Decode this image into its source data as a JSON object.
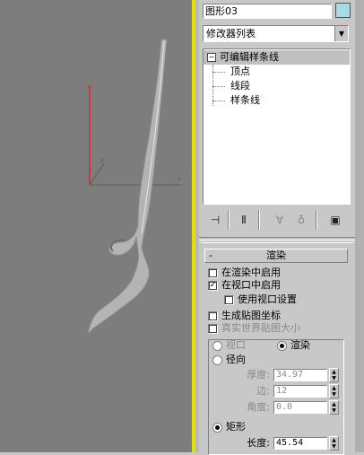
{
  "viewport": {
    "axis_z_label": "z",
    "axis_color_z": "#ff0000",
    "shape_color": "#b4b4b4"
  },
  "panel": {
    "object_name": "图形03",
    "object_color": "#a9dbe6",
    "modifier_list": "修改器列表",
    "stack": {
      "head": "可编辑样条线",
      "head_toggle": "−",
      "items": [
        "顶点",
        "线段",
        "样条线"
      ]
    },
    "icons": [
      "pin-stack-icon",
      "show-end-result-icon",
      "make-unique-icon",
      "remove-modifier-icon",
      "configure-modifier-sets-icon"
    ]
  },
  "render": {
    "title": "渲染",
    "toggle": "-",
    "enable_in_renderer": "在渲染中启用",
    "enable_in_viewport": "在视口中启用",
    "use_viewport_settings": "使用视口设置",
    "generate_mapping": "生成贴图坐标",
    "real_world_map": "真实世界贴图大小",
    "mode_viewport": "视口",
    "mode_render": "渲染",
    "radial": "径向",
    "thickness_label": "厚度:",
    "thickness_value": "34.97",
    "sides_label": "边:",
    "sides_value": "12",
    "angle_label": "角度:",
    "angle_value": "0.0",
    "rectangular": "矩形",
    "length_label": "长度:",
    "length_value": "45.54"
  }
}
